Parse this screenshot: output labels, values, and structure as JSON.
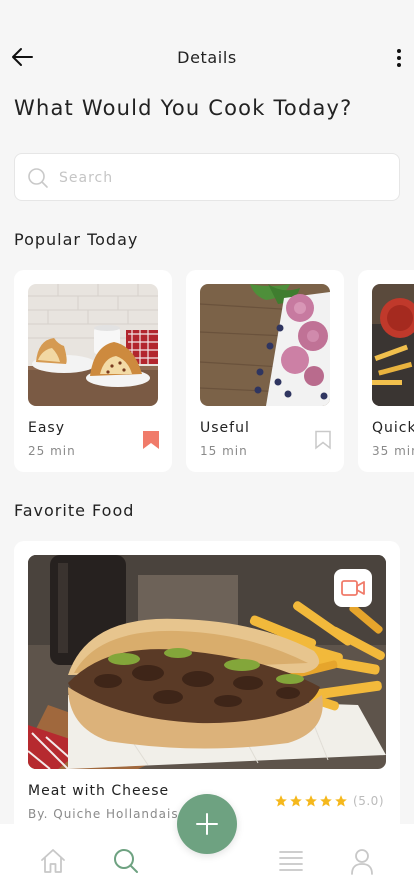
{
  "header": {
    "title": "Details"
  },
  "page_title": "What Would You Cook Today?",
  "search": {
    "placeholder": "Search",
    "value": ""
  },
  "popular": {
    "title": "Popular Today",
    "items": [
      {
        "title": "Easy",
        "time": "25 min",
        "bookmarked": true
      },
      {
        "title": "Useful",
        "time": "15 min",
        "bookmarked": false
      },
      {
        "title": "Quick",
        "time": "35 min",
        "bookmarked": false
      }
    ]
  },
  "favorite": {
    "title": "Favorite Food",
    "item": {
      "name": "Meat with Cheese",
      "author": "By. Quiche Hollandaise",
      "rating": 5,
      "rating_text": "(5.0)"
    }
  },
  "colors": {
    "accent": "#6ea281",
    "bookmark_active": "#f07b6a",
    "star": "#f5b81c",
    "background": "#f6f6f6"
  },
  "tabs": [
    "home-icon",
    "search-icon",
    "add-icon",
    "list-icon",
    "profile-icon"
  ],
  "active_tab": "search-icon"
}
